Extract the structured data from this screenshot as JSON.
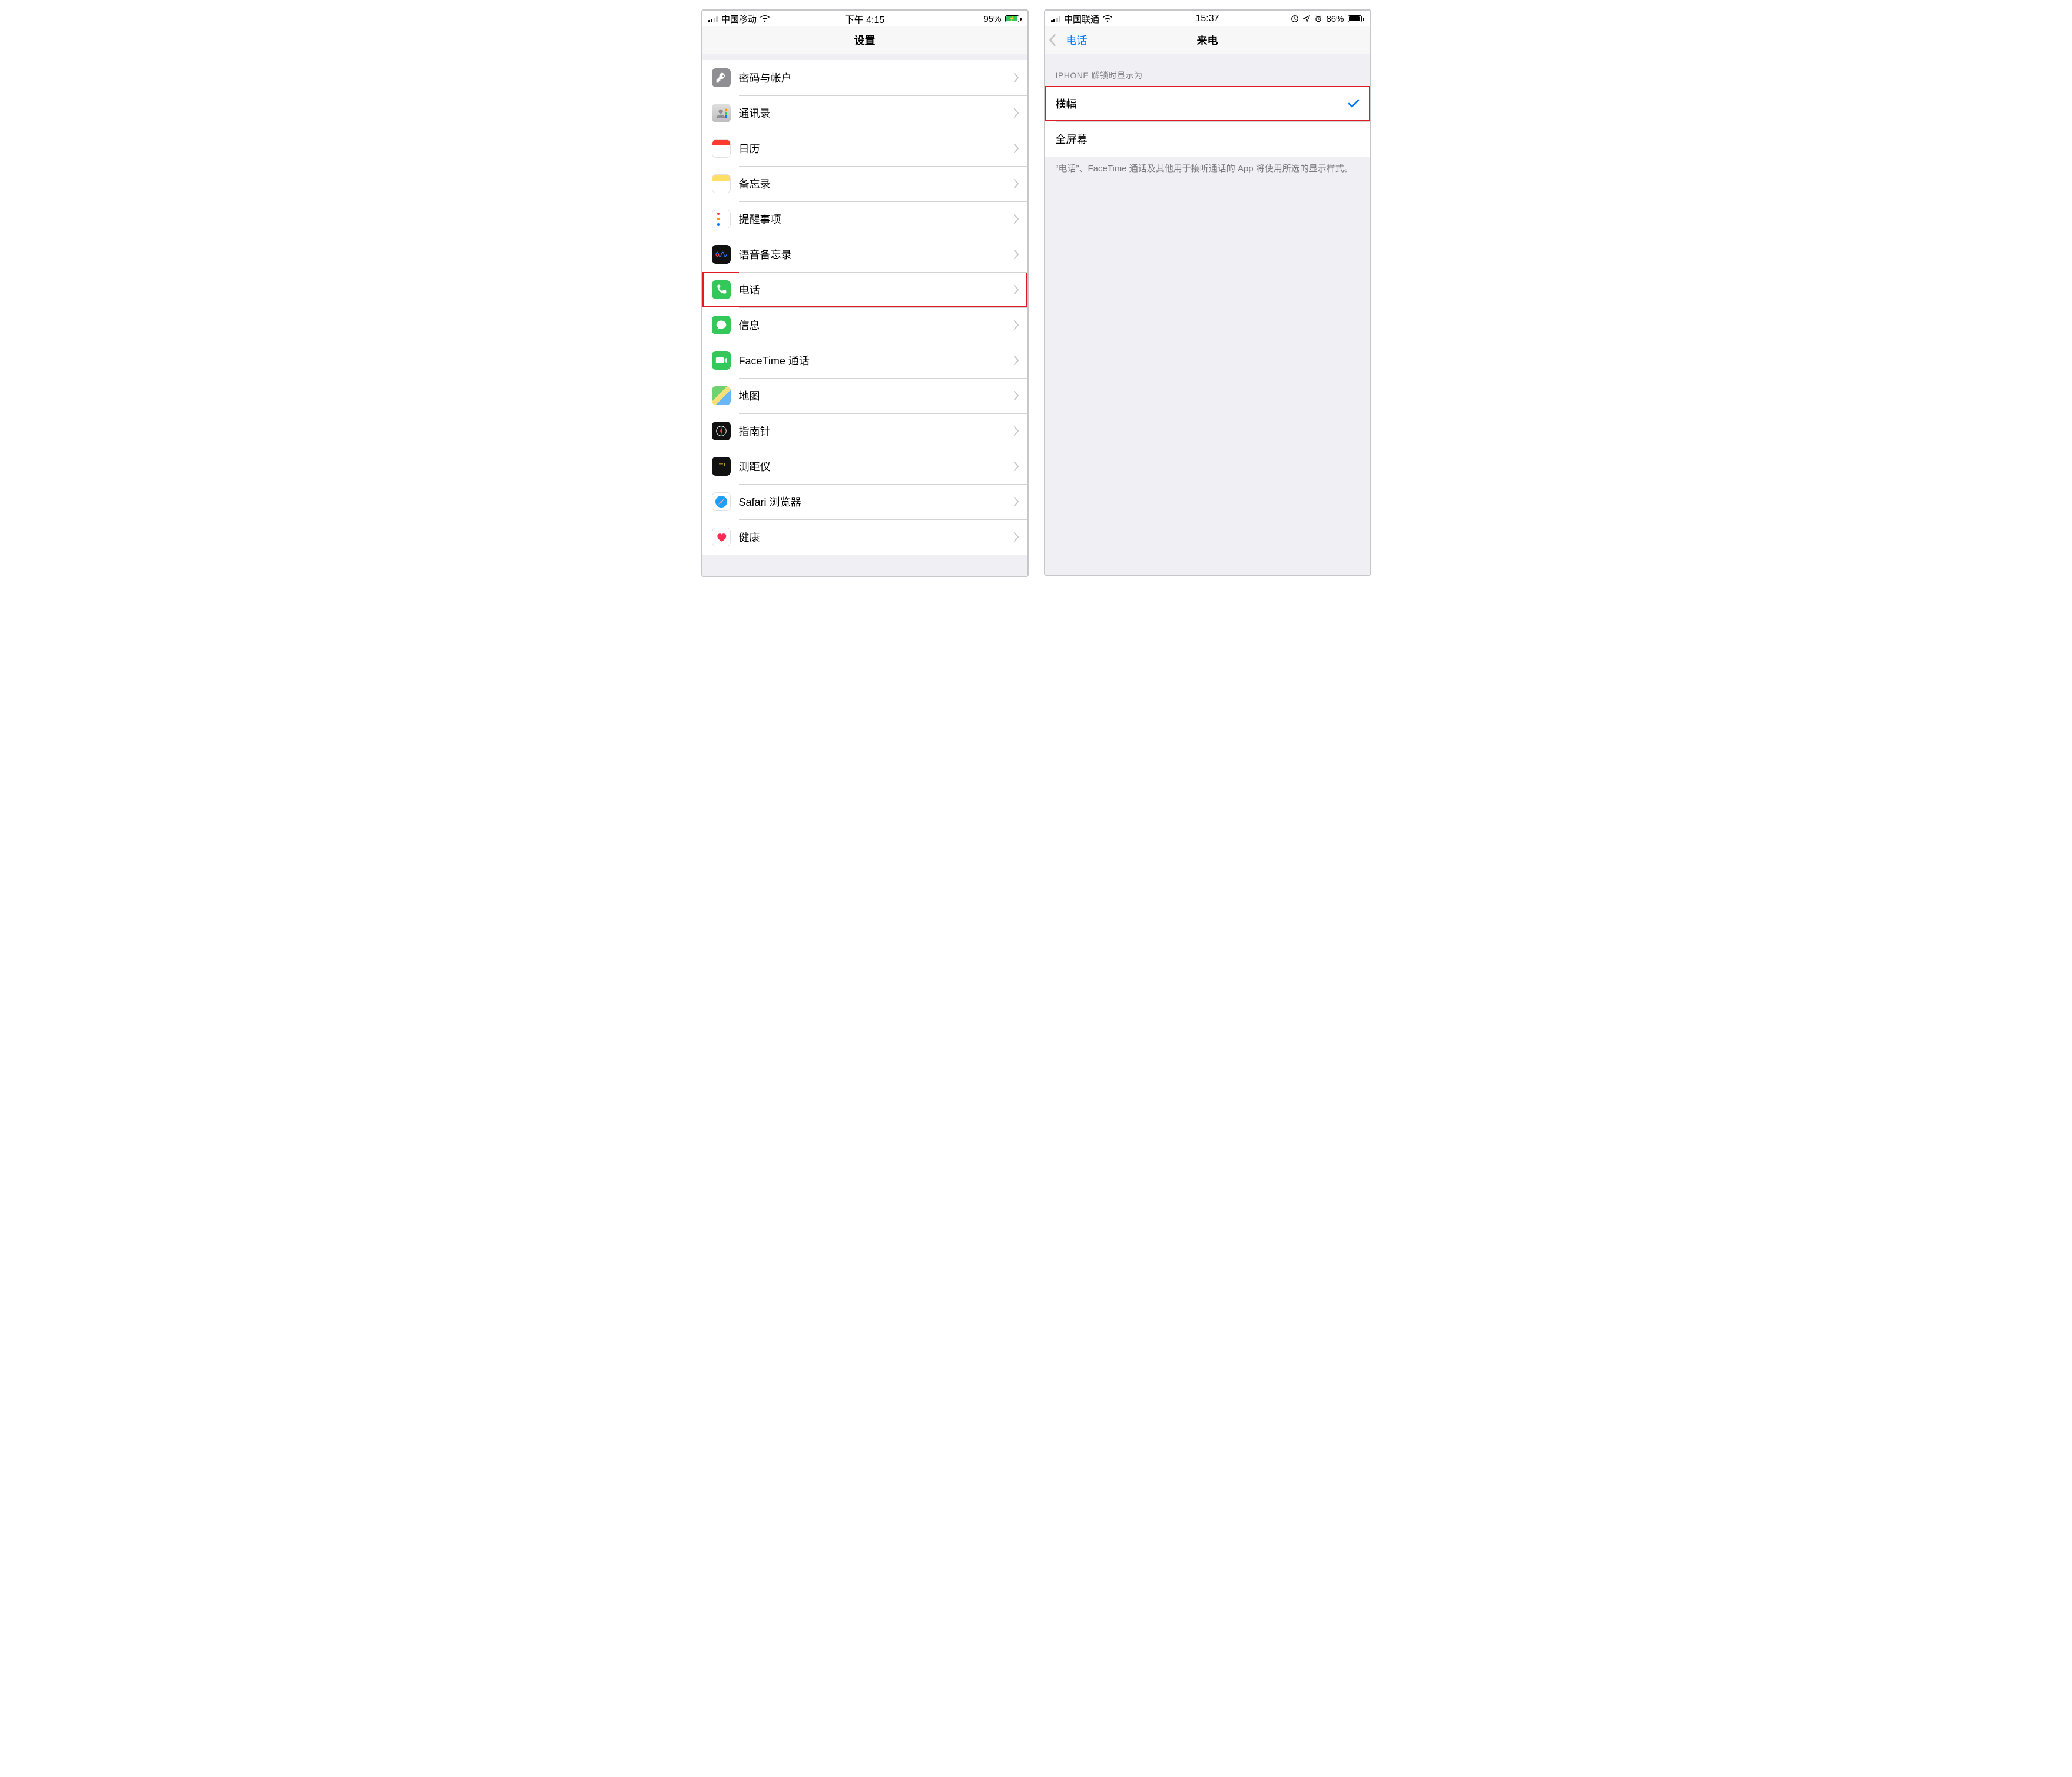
{
  "left": {
    "status": {
      "carrier": "中国移动",
      "time": "下午 4:15",
      "battery_pct": "95%"
    },
    "nav": {
      "title": "设置"
    },
    "rows": [
      {
        "id": "passwords-accounts",
        "icon": "key-icon",
        "label": "密码与帐户"
      },
      {
        "id": "contacts",
        "icon": "contacts-icon",
        "label": "通讯录"
      },
      {
        "id": "calendar",
        "icon": "calendar-icon",
        "label": "日历"
      },
      {
        "id": "notes",
        "icon": "notes-icon",
        "label": "备忘录"
      },
      {
        "id": "reminders",
        "icon": "reminders-icon",
        "label": "提醒事项"
      },
      {
        "id": "voice-memos",
        "icon": "voice-icon",
        "label": "语音备忘录"
      },
      {
        "id": "phone",
        "icon": "phone-icon",
        "label": "电话",
        "highlight": true
      },
      {
        "id": "messages",
        "icon": "messages-icon",
        "label": "信息"
      },
      {
        "id": "facetime",
        "icon": "facetime-icon",
        "label": "FaceTime 通话"
      },
      {
        "id": "maps",
        "icon": "maps-icon",
        "label": "地图"
      },
      {
        "id": "compass",
        "icon": "compass-icon",
        "label": "指南针"
      },
      {
        "id": "measure",
        "icon": "measure-icon",
        "label": "测距仪"
      },
      {
        "id": "safari",
        "icon": "safari-icon",
        "label": "Safari 浏览器"
      },
      {
        "id": "health",
        "icon": "health-icon",
        "label": "健康"
      }
    ]
  },
  "right": {
    "status": {
      "carrier": "中国联通",
      "time": "15:37",
      "battery_pct": "86%"
    },
    "nav": {
      "back": "电话",
      "title": "来电"
    },
    "group_header": "IPHONE 解锁时显示为",
    "options": [
      {
        "id": "banner",
        "label": "横幅",
        "selected": true,
        "highlight": true
      },
      {
        "id": "fullscreen",
        "label": "全屏幕",
        "selected": false
      }
    ],
    "group_footer": "“电话”、FaceTime 通话及其他用于接听通话的 App 将使用所选的显示样式。"
  }
}
